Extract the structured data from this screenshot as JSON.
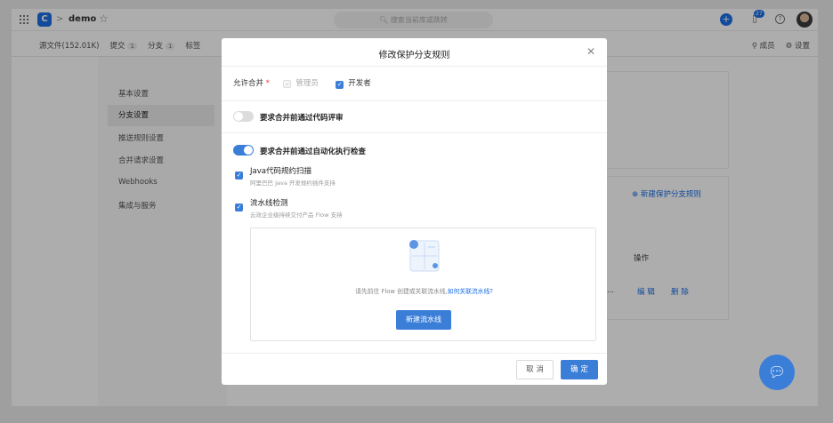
{
  "topbar": {
    "project": "demo",
    "breadcrumb_sep": ">",
    "search_placeholder": "搜索当前库或跳转",
    "notification_count": "27"
  },
  "subnav": {
    "tabs": [
      {
        "label": "源文件(152.01K)",
        "count": ""
      },
      {
        "label": "提交",
        "count": "1"
      },
      {
        "label": "分支",
        "count": "1"
      },
      {
        "label": "标签",
        "count": ""
      }
    ],
    "members": "成员",
    "settings": "设置"
  },
  "sidebar": {
    "items": [
      {
        "label": "基本设置"
      },
      {
        "label": "分支设置",
        "active": true
      },
      {
        "label": "推送规则设置"
      },
      {
        "label": "合并请求设置"
      },
      {
        "label": "Webhooks"
      },
      {
        "label": "集成与服务"
      }
    ]
  },
  "panel": {
    "new_rule": "新建保护分支规则",
    "op_header": "操作",
    "ellipsis": "...",
    "edit": "编 辑",
    "delete": "删 除"
  },
  "modal": {
    "title": "修改保护分支规则",
    "allow_merge_label": "允许合并",
    "required_mark": "*",
    "role_admin": "管理员",
    "role_dev": "开发者",
    "code_review_label": "要求合并前通过代码评审",
    "auto_check_label": "要求合并前通过自动化执行检查",
    "checks": [
      {
        "title": "Java代码规约扫描",
        "desc": "阿里巴巴 Java 开发规约插件支持"
      },
      {
        "title": "流水线检测",
        "desc": "云效企业级持续交付产品 Flow 支持"
      }
    ],
    "empty_text": "请先前往 Flow 创建或关联流水线,",
    "empty_link": "如何关联流水线?",
    "new_pipeline": "新建流水线",
    "cancel": "取 消",
    "confirm": "确 定"
  },
  "colors": {
    "accent": "#3b7ed8",
    "brand": "#1b6fe5",
    "overlay": "rgba(0,0,0,0.32)"
  }
}
